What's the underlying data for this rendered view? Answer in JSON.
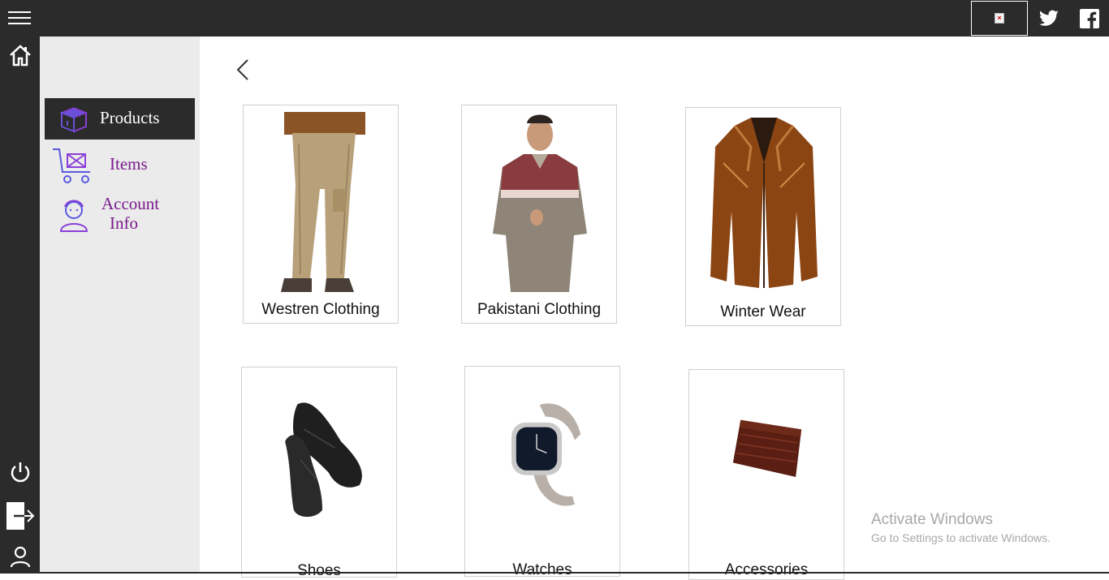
{
  "sidebar": {
    "items": [
      {
        "label": "Products",
        "icon": "box-icon"
      },
      {
        "label": "Items",
        "icon": "cart-icon"
      },
      {
        "label": "Account",
        "label2": "Info",
        "icon": "user-avatar-icon"
      }
    ]
  },
  "cards": [
    {
      "label": "Westren Clothing"
    },
    {
      "label": "Pakistani Clothing"
    },
    {
      "label": "Winter Wear"
    },
    {
      "label": "Shoes"
    },
    {
      "label": "Watches"
    },
    {
      "label": "Accessories"
    }
  ],
  "watermark": {
    "title": "Activate Windows",
    "subtitle": "Go to Settings to activate Windows."
  },
  "colors": {
    "dark": "#2b2b2b",
    "panel": "#ebebeb",
    "accent_purple": "#7a1a8c",
    "icon_blue": "#4a5be0"
  }
}
